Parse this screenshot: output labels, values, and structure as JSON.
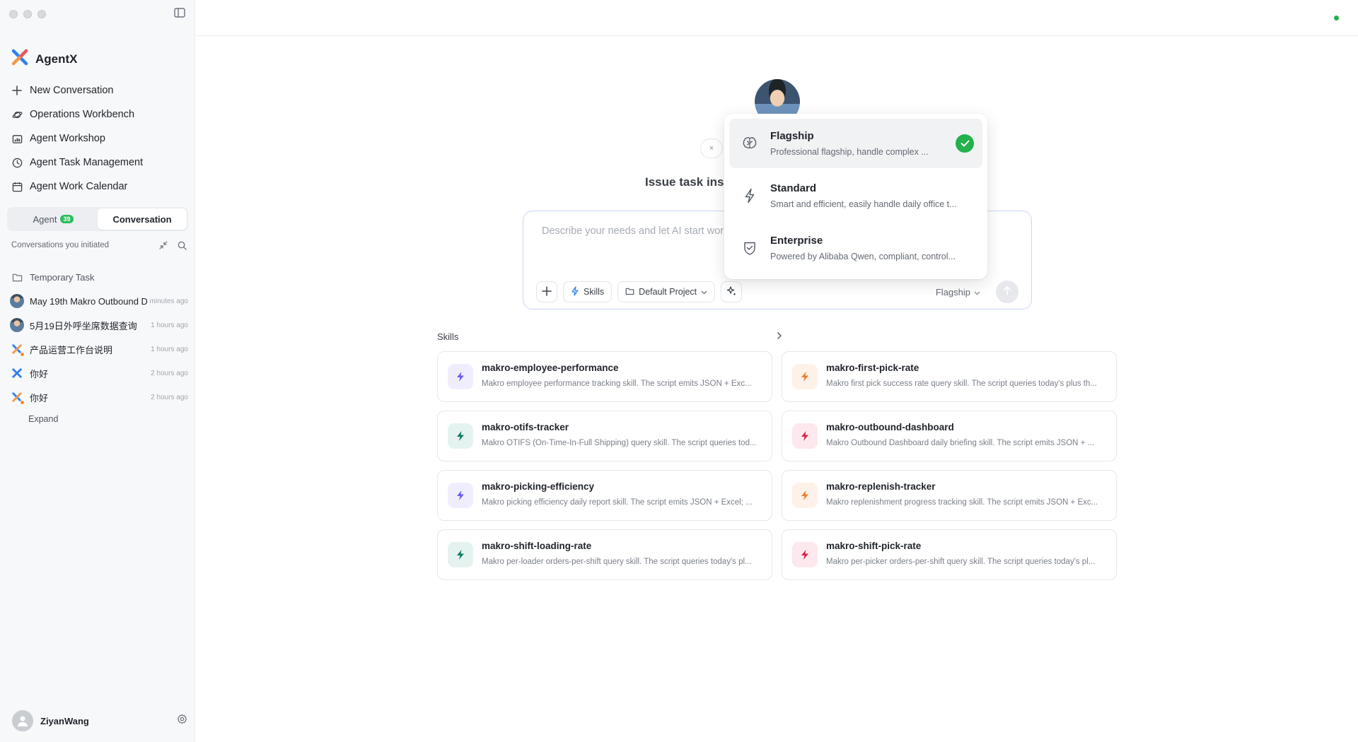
{
  "app": {
    "name": "AgentX",
    "status_color": "#22b14c",
    "accent": "#2bbc5c"
  },
  "nav": [
    {
      "label": "New Conversation",
      "icon": "plus-icon"
    },
    {
      "label": "Operations Workbench",
      "icon": "planet-icon"
    },
    {
      "label": "Agent Workshop",
      "icon": "workshop-icon"
    },
    {
      "label": "Agent Task Management",
      "icon": "clock-icon"
    },
    {
      "label": "Agent Work Calendar",
      "icon": "calendar-icon"
    }
  ],
  "sidebar_tabs": {
    "agent_label": "Agent",
    "agent_count": "39",
    "conversation_label": "Conversation",
    "active": "Conversation"
  },
  "conversations": {
    "header": "Conversations you initiated",
    "folder": "Temporary Task",
    "items": [
      {
        "title": "May 19th Makro Outbound D",
        "time": "minutes ago"
      },
      {
        "title": "5月19日外呼坐席数据查询",
        "time": "1 hours ago"
      },
      {
        "title": "产品运营工作台说明",
        "time": "1 hours ago"
      },
      {
        "title": "你好",
        "time": "2 hours ago"
      },
      {
        "title": "你好",
        "time": "2 hours ago"
      }
    ],
    "expand_label": "Expand"
  },
  "user": {
    "name": "ZiyanWang"
  },
  "main": {
    "close_label": "×",
    "issue_title": "Issue task ins",
    "composer": {
      "placeholder": "Describe your needs and let AI start work",
      "skills_label": "Skills",
      "project_label": "Default Project",
      "model_label": "Flagship"
    },
    "skills_title": "Skills",
    "skills": [
      {
        "name": "makro-employee-performance",
        "desc": "Makro employee performance tracking skill. The script emits JSON + Exc...",
        "color": "#6b5cf0",
        "bg": "#f0eefe"
      },
      {
        "name": "makro-first-pick-rate",
        "desc": "Makro first pick success rate query skill. The script queries today's plus th...",
        "color": "#f07b2e",
        "bg": "#fef1e7"
      },
      {
        "name": "makro-otifs-tracker",
        "desc": "Makro OTIFS (On-Time-In-Full Shipping) query skill. The script queries tod...",
        "color": "#0f7a64",
        "bg": "#e5f3f0"
      },
      {
        "name": "makro-outbound-dashboard",
        "desc": "Makro Outbound Dashboard daily briefing skill. The script emits JSON + ...",
        "color": "#d6224c",
        "bg": "#fce8ed"
      },
      {
        "name": "makro-picking-efficiency",
        "desc": "Makro picking efficiency daily report skill. The script emits JSON + Excel; ...",
        "color": "#6b5cf0",
        "bg": "#f0eefe"
      },
      {
        "name": "makro-replenish-tracker",
        "desc": "Makro replenishment progress tracking skill. The script emits JSON + Exc...",
        "color": "#f07b2e",
        "bg": "#fef1e7"
      },
      {
        "name": "makro-shift-loading-rate",
        "desc": "Makro per-loader orders-per-shift query skill. The script queries today's pl...",
        "color": "#0f7a64",
        "bg": "#e5f3f0"
      },
      {
        "name": "makro-shift-pick-rate",
        "desc": "Makro per-picker orders-per-shift query skill. The script queries today's pl...",
        "color": "#d6224c",
        "bg": "#fce8ed"
      }
    ]
  },
  "model_dropdown": {
    "options": [
      {
        "title": "Flagship",
        "desc": "Professional flagship, handle complex ...",
        "icon": "brain-icon",
        "selected": true
      },
      {
        "title": "Standard",
        "desc": "Smart and efficient, easily handle daily office t...",
        "icon": "lightning-icon",
        "selected": false
      },
      {
        "title": "Enterprise",
        "desc": "Powered by Alibaba Qwen, compliant, control...",
        "icon": "shield-check-icon",
        "selected": false
      }
    ]
  }
}
